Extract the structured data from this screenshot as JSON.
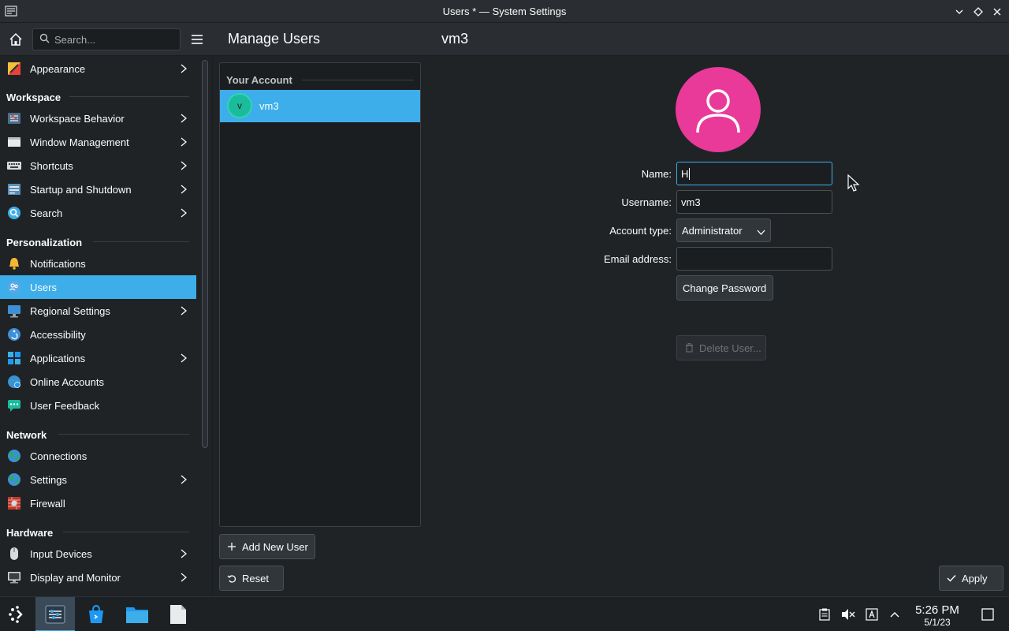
{
  "window": {
    "title": "Users * — System Settings"
  },
  "header": {
    "search_placeholder": "Search...",
    "page_title": "Manage Users",
    "sub_title": "vm3"
  },
  "sidebar": {
    "items": [
      {
        "label": "Appearance",
        "icon": "appearance-icon",
        "chevron": true
      },
      {
        "section": "Workspace"
      },
      {
        "label": "Workspace Behavior",
        "icon": "workspace-behavior-icon",
        "chevron": true
      },
      {
        "label": "Window Management",
        "icon": "window-management-icon",
        "chevron": true
      },
      {
        "label": "Shortcuts",
        "icon": "keyboard-icon",
        "chevron": true
      },
      {
        "label": "Startup and Shutdown",
        "icon": "startup-icon",
        "chevron": true
      },
      {
        "label": "Search",
        "icon": "search-icon",
        "chevron": true
      },
      {
        "section": "Personalization"
      },
      {
        "label": "Notifications",
        "icon": "bell-icon",
        "chevron": false
      },
      {
        "label": "Users",
        "icon": "users-icon",
        "chevron": false,
        "active": true
      },
      {
        "label": "Regional Settings",
        "icon": "regional-icon",
        "chevron": true
      },
      {
        "label": "Accessibility",
        "icon": "accessibility-icon",
        "chevron": false
      },
      {
        "label": "Applications",
        "icon": "applications-icon",
        "chevron": true
      },
      {
        "label": "Online Accounts",
        "icon": "online-accounts-icon",
        "chevron": false
      },
      {
        "label": "User Feedback",
        "icon": "feedback-icon",
        "chevron": false
      },
      {
        "section": "Network"
      },
      {
        "label": "Connections",
        "icon": "globe-icon",
        "chevron": false
      },
      {
        "label": "Settings",
        "icon": "globe-icon",
        "chevron": true
      },
      {
        "label": "Firewall",
        "icon": "firewall-icon",
        "chevron": false
      },
      {
        "section": "Hardware"
      },
      {
        "label": "Input Devices",
        "icon": "mouse-icon",
        "chevron": true
      },
      {
        "label": "Display and Monitor",
        "icon": "monitor-icon",
        "chevron": true
      }
    ]
  },
  "users_panel": {
    "heading": "Your Account",
    "users": [
      {
        "initial": "v",
        "name": "vm3",
        "selected": true
      }
    ],
    "add_button": "Add New User",
    "reset_button": "Reset"
  },
  "form": {
    "name_label": "Name:",
    "name_value": "H",
    "username_label": "Username:",
    "username_value": "vm3",
    "account_type_label": "Account type:",
    "account_type_value": "Administrator",
    "email_label": "Email address:",
    "email_value": "",
    "change_password_button": "Change Password",
    "delete_user_button": "Delete User..."
  },
  "apply_button": "Apply",
  "taskbar": {
    "time": "5:26 PM",
    "date": "5/1/23"
  },
  "colors": {
    "accent": "#3daee9",
    "avatar": "#e93a9a",
    "background": "#202326"
  }
}
